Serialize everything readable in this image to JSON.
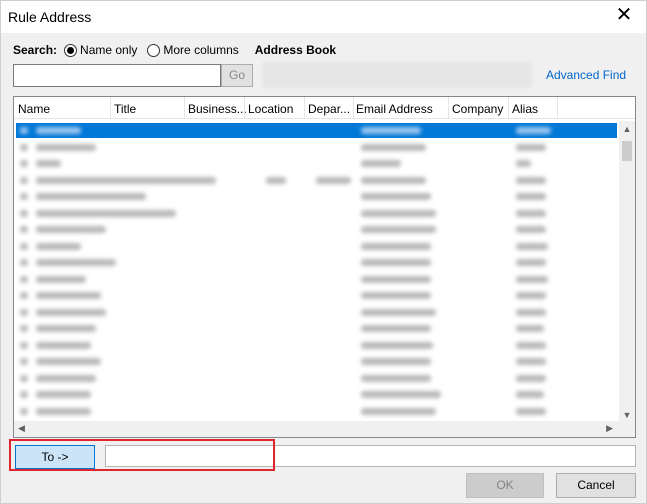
{
  "window": {
    "title": "Rule Address",
    "close_glyph": "✕"
  },
  "search": {
    "label": "Search:",
    "option_name_only": "Name only",
    "option_more_columns": "More columns",
    "selected": "Name only",
    "value": "",
    "placeholder": "",
    "go_label": "Go"
  },
  "address_book": {
    "label": "Address Book",
    "selected": "",
    "advanced_find": "Advanced Find"
  },
  "columns": [
    "Name",
    "Title",
    "Business...",
    "Location",
    "Depar...",
    "Email Address",
    "Company",
    "Alias"
  ],
  "recipients": {
    "to_label": "To ->",
    "to_value": ""
  },
  "buttons": {
    "ok": "OK",
    "cancel": "Cancel"
  },
  "colors": {
    "selection": "#0078d7",
    "highlight_box": "#e0252f",
    "link": "#0066cc"
  }
}
